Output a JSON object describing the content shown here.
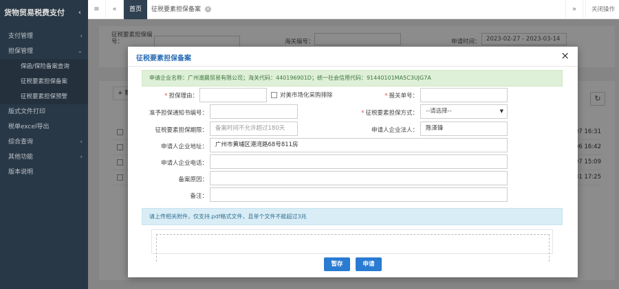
{
  "app": {
    "title": "货物贸易税费支付",
    "collapse_icon": "‹"
  },
  "sidebar": {
    "items": [
      {
        "label": "支付管理",
        "arrow": "‹"
      },
      {
        "label": "担保管理",
        "arrow": "⌄"
      },
      {
        "label": "保函/保险备案查询"
      },
      {
        "label": "征税要素担保备案"
      },
      {
        "label": "征税要素担保预警"
      },
      {
        "label": "版式文件打印"
      },
      {
        "label": "税单excel导出"
      },
      {
        "label": "综合查询",
        "arrow": "‹"
      },
      {
        "label": "其他功能",
        "arrow": "‹"
      },
      {
        "label": "版本说明"
      }
    ]
  },
  "topbar": {
    "menu_icon": "≡",
    "back_icon": "«",
    "home_tab": "首页",
    "active_tab": "征税要素担保备案",
    "tab_close": "×",
    "forward_icon": "»",
    "close_ops": "关闭操作"
  },
  "search": {
    "label_guarantee_no": "征税要素担保编号：",
    "label_customs_no": "海关编号：",
    "label_apply_time": "申请时间：",
    "apply_time_value": "2023-02-27 - 2023-03-14"
  },
  "list": {
    "add_btn": "+ 新",
    "refresh_icon": "↻",
    "row_times": [
      "07 16:31",
      "06 16:42",
      "07 15:09",
      "31 17:25"
    ]
  },
  "modal": {
    "title": "征税要素担保备案",
    "close_icon": "×",
    "info": "申请企业名称：广州潮晨贸易有限公司；海关代码：440196901D；统一社会信用代码：91440101MA5C3UJG7A",
    "fields": {
      "reason_label": "担保理由：",
      "reason_value": "",
      "special_check_label": "对美市场化采购排除",
      "declaration_label": "报关单号：",
      "declaration_value": "",
      "notice_label": "准予担保通知书编号：",
      "notice_value": "",
      "method_label": "征税要素担保方式：",
      "method_value": "--请选择--",
      "period_label": "征税要素担保期限：",
      "period_placeholder": "备案时间不允许超过180天",
      "legal_label": "申请人企业法人：",
      "legal_value": "陈泽锋",
      "address_label": "申请人企业地址：",
      "address_value": "广州市黄埔区港湾路68号811房",
      "phone_label": "申请人企业电话：",
      "phone_value": "",
      "cause_label": "备案原因：",
      "cause_value": "",
      "remark_label": "备注：",
      "remark_value": ""
    },
    "required_mark": "*",
    "upload_note": "请上传相关附件，仅支持.pdf格式文件，且单个文件不能超过3兆",
    "save_button": "暂存",
    "submit_button": "申请"
  }
}
